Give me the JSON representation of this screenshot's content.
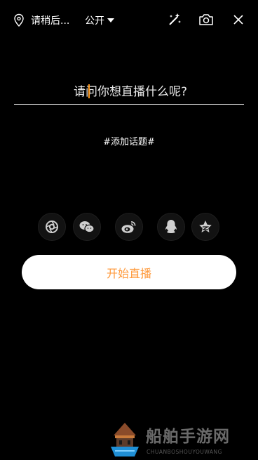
{
  "header": {
    "location_text": "请稍后...",
    "privacy_label": "公开"
  },
  "title_input": {
    "placeholder": "请问你想直播什么呢?",
    "value": ""
  },
  "topic": {
    "label": "#添加话题#"
  },
  "share_targets": [
    {
      "icon": "moments-icon"
    },
    {
      "icon": "wechat-icon"
    },
    {
      "icon": "weibo-icon"
    },
    {
      "icon": "qq-icon"
    },
    {
      "icon": "qzone-icon"
    }
  ],
  "start_button": {
    "label": "开始直播",
    "color": "#ff9a3c"
  },
  "watermark": {
    "title": "船舶手游网",
    "subtitle": "CHUANBOSHOUYOUWANG"
  },
  "colors": {
    "background": "#000000",
    "accent": "#ff9a1f"
  }
}
